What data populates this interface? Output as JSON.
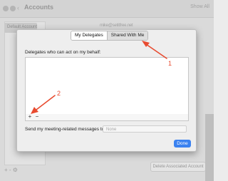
{
  "background_window": {
    "title": "Accounts",
    "show_all": "Show All",
    "sidebar_selected_title": "Default Account",
    "sidebar_selected_sub": "",
    "email_partial": "mike@setitfree.net",
    "bottom_controls": "+ - ⚙",
    "detail_button": "Delete Associated Account"
  },
  "sheet": {
    "tabs": [
      {
        "label": "My Delegates",
        "active": true
      },
      {
        "label": "Shared With Me",
        "active": false
      }
    ],
    "list_label": "Delegates who can act on my behalf:",
    "add_button": "+",
    "remove_button": "−",
    "send_label": "Send my meeting-related messages to:",
    "send_value": "None",
    "done_button": "Done"
  },
  "annotations": {
    "arrow_color": "#e84b30",
    "label_1": "1",
    "label_2": "2"
  }
}
